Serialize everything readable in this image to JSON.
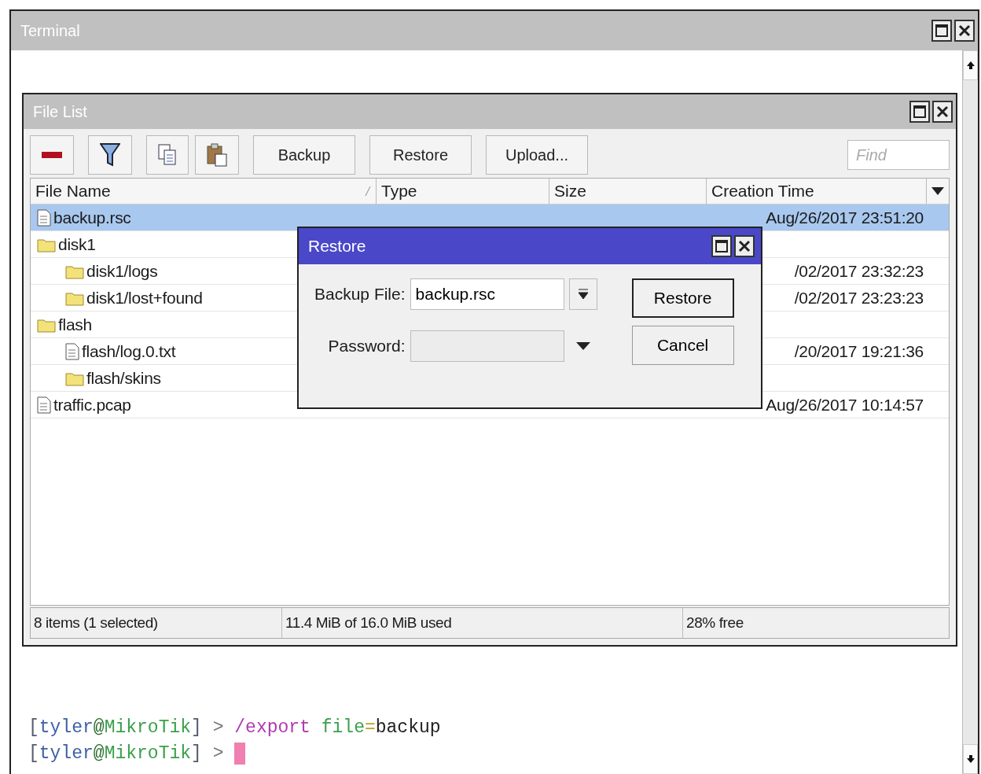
{
  "window": {
    "title": "Terminal"
  },
  "file_list": {
    "title": "File List",
    "toolbar": [
      {
        "kind": "remove"
      },
      {
        "kind": "filter"
      },
      {
        "kind": "copy"
      },
      {
        "kind": "paste"
      },
      {
        "kind": "text",
        "label": "Backup"
      },
      {
        "kind": "text",
        "label": "Restore"
      },
      {
        "kind": "text",
        "label": "Upload..."
      }
    ],
    "search": {
      "placeholder": "Find"
    },
    "columns": [
      "File Name",
      "Type",
      "Size",
      "Creation Time"
    ],
    "rows": [
      {
        "name": "backup.rsc",
        "kind": "file",
        "selected": true,
        "time": "Aug/26/2017 23:51:20",
        "children": []
      },
      {
        "name": "disk1",
        "kind": "folder",
        "selected": false,
        "children": [
          {
            "name": "disk1/logs",
            "kind": "folder",
            "selected": false,
            "time": "/02/2017 23:32:23"
          },
          {
            "name": "disk1/lost+found",
            "kind": "folder",
            "selected": false,
            "time": "/02/2017 23:23:23"
          }
        ]
      },
      {
        "name": "flash",
        "kind": "folder",
        "selected": false,
        "children": [
          {
            "name": "flash/log.0.txt",
            "kind": "file",
            "selected": false,
            "time": "/20/2017 19:21:36"
          },
          {
            "name": "flash/skins",
            "kind": "folder",
            "selected": false
          }
        ]
      },
      {
        "name": "traffic.pcap",
        "kind": "file",
        "selected": false,
        "time": "Aug/26/2017 10:14:57",
        "children": []
      }
    ],
    "status_bar": [
      "8 items (1 selected)",
      "11.4 MiB of 16.0 MiB used",
      "28% free"
    ]
  },
  "dialog": {
    "title": "Restore",
    "fields": [
      {
        "label": "Backup File:",
        "value": "backup.rsc",
        "kind": "select",
        "disabled": false
      },
      {
        "label": "Password:",
        "kind": "password",
        "disabled": true
      }
    ],
    "buttons": [
      "Restore",
      "Cancel"
    ]
  },
  "terminal_lines": [
    {
      "segments": [
        {
          "text": "[",
          "kind": "bracket"
        },
        {
          "text": "tyler",
          "kind": "user"
        },
        {
          "text": "@",
          "kind": "at"
        },
        {
          "text": "MikroTik",
          "kind": "host"
        },
        {
          "text": "]",
          "kind": "bracket"
        },
        {
          "text": " > ",
          "kind": "prompt"
        },
        {
          "text": "/export",
          "kind": "command"
        },
        {
          "text": " file",
          "kind": "param"
        },
        {
          "text": "=",
          "kind": "equals"
        },
        {
          "text": "backup",
          "kind": "value"
        }
      ]
    },
    {
      "segments": [
        {
          "text": "[",
          "kind": "bracket"
        },
        {
          "text": "tyler",
          "kind": "user"
        },
        {
          "text": "@",
          "kind": "at"
        },
        {
          "text": "MikroTik",
          "kind": "host"
        },
        {
          "text": "]",
          "kind": "bracket"
        },
        {
          "text": " > ",
          "kind": "prompt"
        }
      ],
      "cursor": true
    }
  ]
}
